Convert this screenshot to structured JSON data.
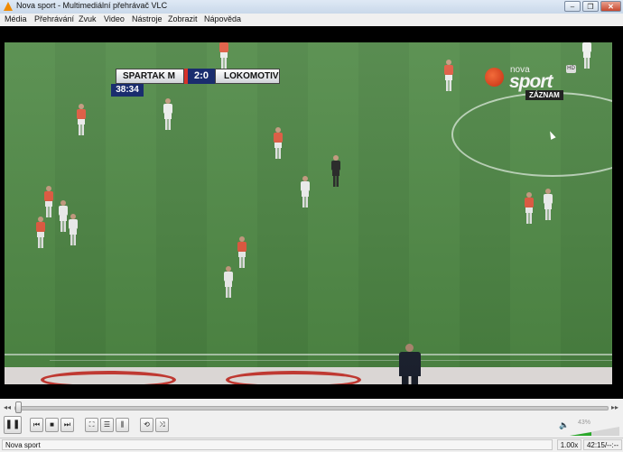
{
  "window": {
    "title": "Nova sport - Multimediální přehrávač VLC",
    "minimize_label": "–",
    "maximize_label": "❐",
    "close_label": "✕"
  },
  "menu": {
    "items": [
      "Média",
      "Přehrávání",
      "Zvuk",
      "Video",
      "Nástroje",
      "Zobrazit",
      "Nápověda"
    ]
  },
  "broadcast": {
    "home_team": "SPARTAK M",
    "score": "2:0",
    "away_team": "LOKOMOTIV",
    "match_time": "38:34",
    "channel_top": "nova",
    "channel_main": "sport",
    "channel_hd": "HD",
    "replay_tag": "ZÁZNAM"
  },
  "controls": {
    "seek_progress": 0.0,
    "prev_label": "◂◂",
    "next_label": "▸▸",
    "play_label": "❚❚",
    "buttons": [
      "⏮",
      "■",
      "⏭",
      "⛶",
      "☰",
      "⫼",
      "⟲",
      "⤨"
    ],
    "volume_label": "43%",
    "volume": 0.43
  },
  "status": {
    "media_name": "Nova sport",
    "speed": "1.00x",
    "time": "42:15/--:--"
  }
}
